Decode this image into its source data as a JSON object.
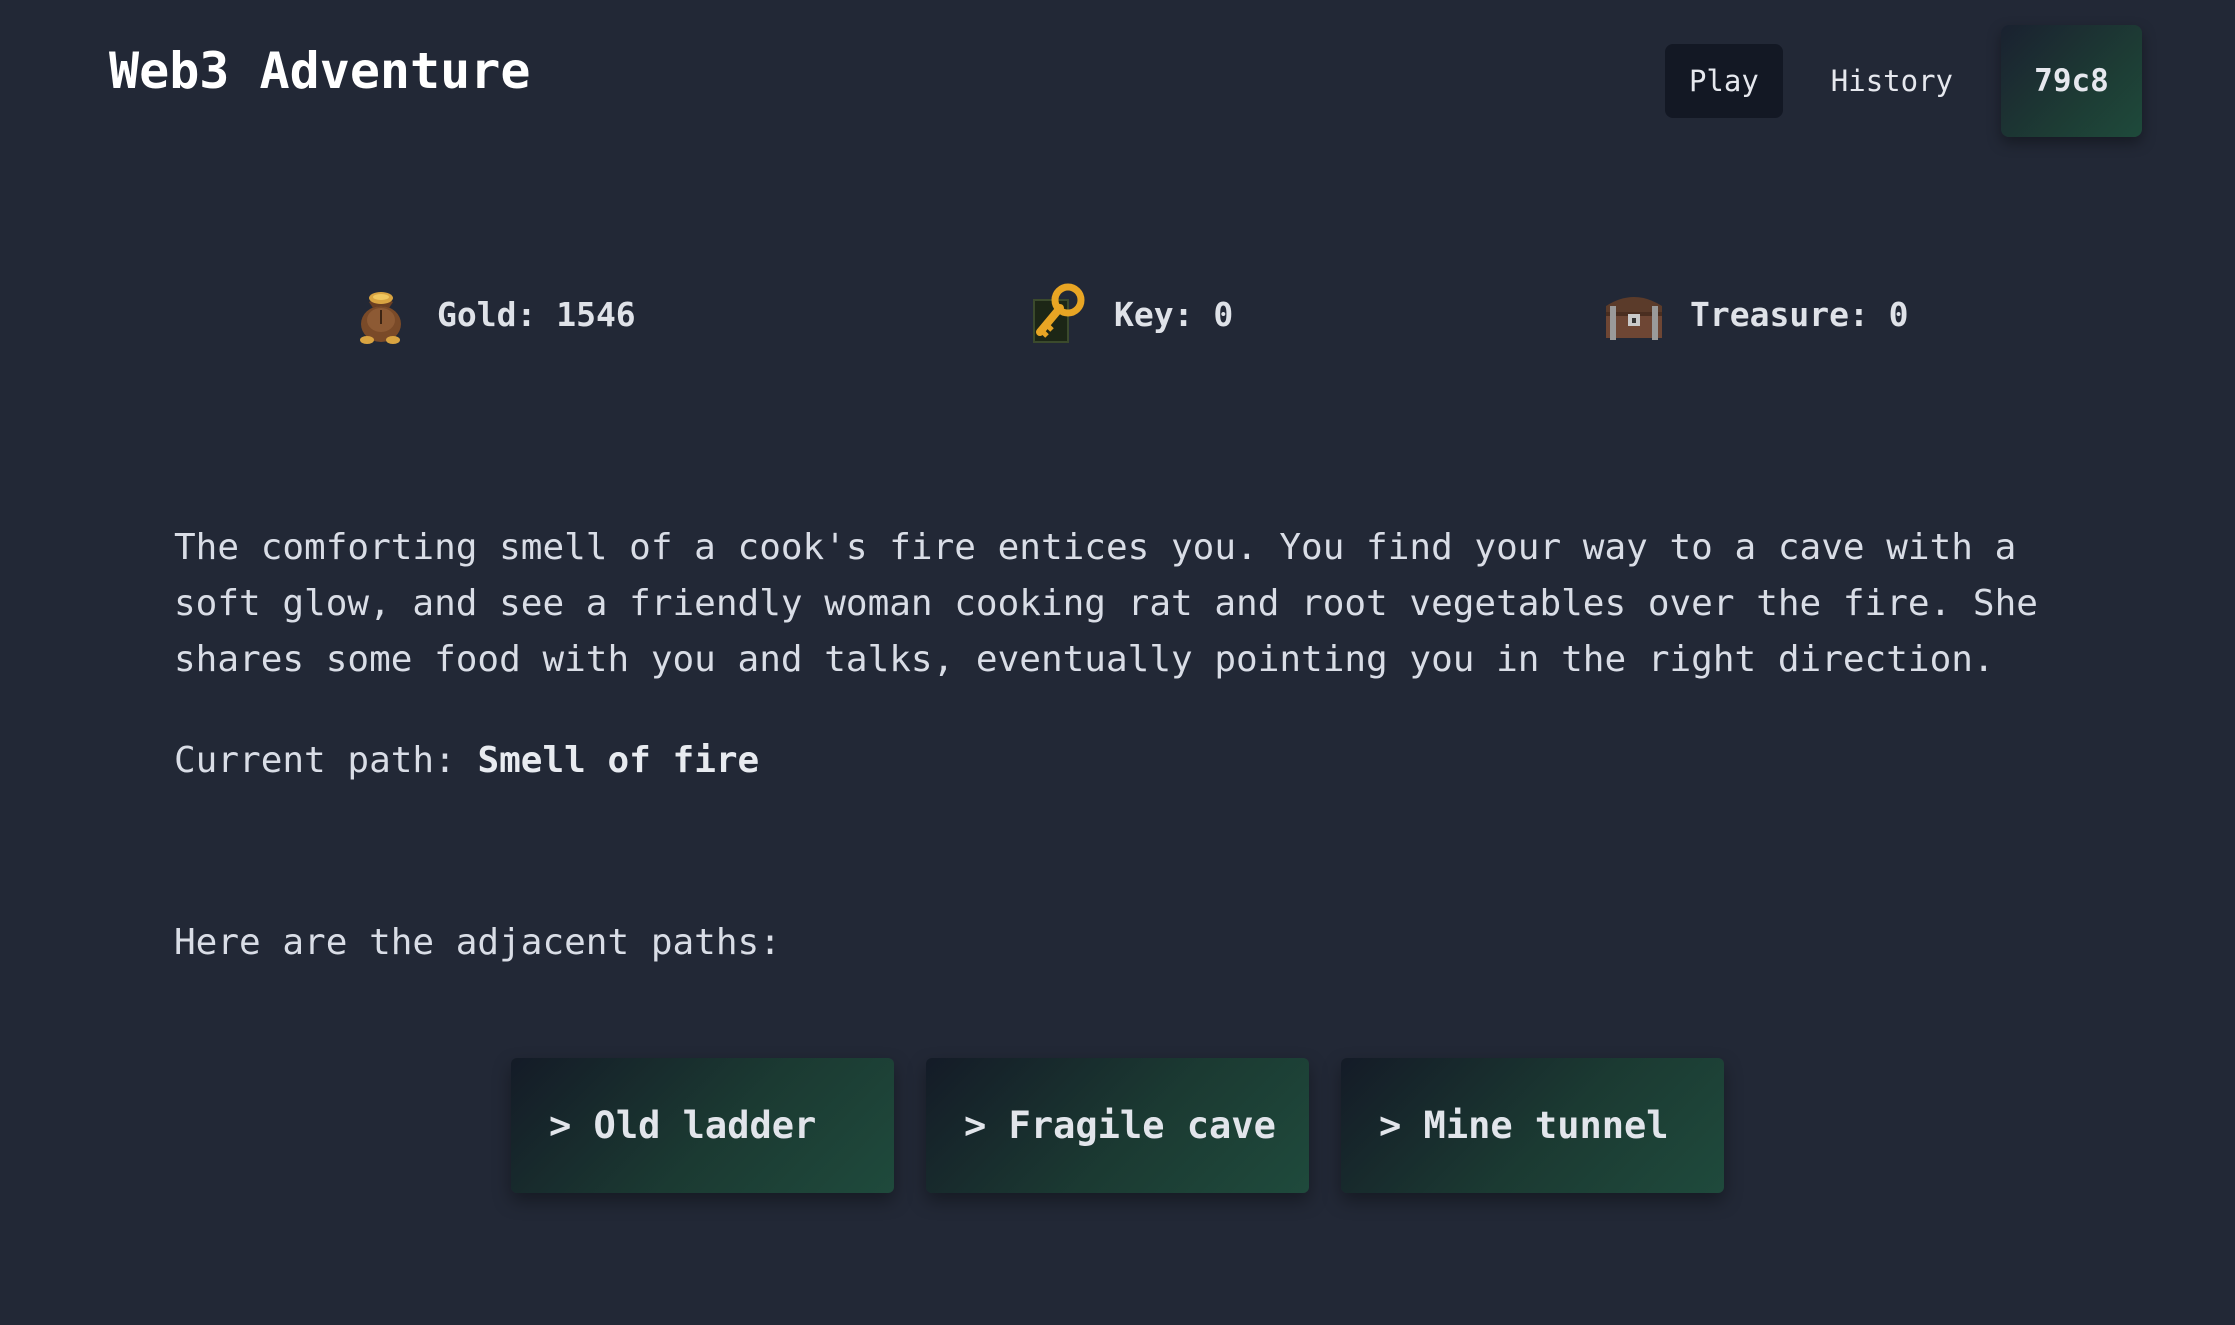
{
  "header": {
    "title": "Web3 Adventure",
    "nav": {
      "play_label": "Play",
      "history_label": "History",
      "wallet_label": "79c8"
    }
  },
  "stats": {
    "gold": {
      "label": "Gold: 1546",
      "icon": "gold-bag-icon"
    },
    "key": {
      "label": "Key: 0",
      "icon": "key-icon"
    },
    "treasure": {
      "label": "Treasure: 0",
      "icon": "treasure-chest-icon"
    }
  },
  "story": {
    "text": "The comforting smell of a cook's fire entices you. You find your way to a cave with a soft glow, and see a friendly woman cooking rat and root vegetables over the fire. She shares some food with you and talks, eventually pointing you in the right direction.",
    "current_path_label": "Current path:",
    "current_path_value": "Smell of fire",
    "adjacent_heading": "Here are the adjacent paths:"
  },
  "paths": [
    {
      "label": "> Old ladder"
    },
    {
      "label": "> Fragile cave"
    },
    {
      "label": "> Mine tunnel"
    }
  ],
  "colors": {
    "background": "#222836",
    "button_gradient_start": "#141b27",
    "button_gradient_end": "#1f4a3c"
  }
}
